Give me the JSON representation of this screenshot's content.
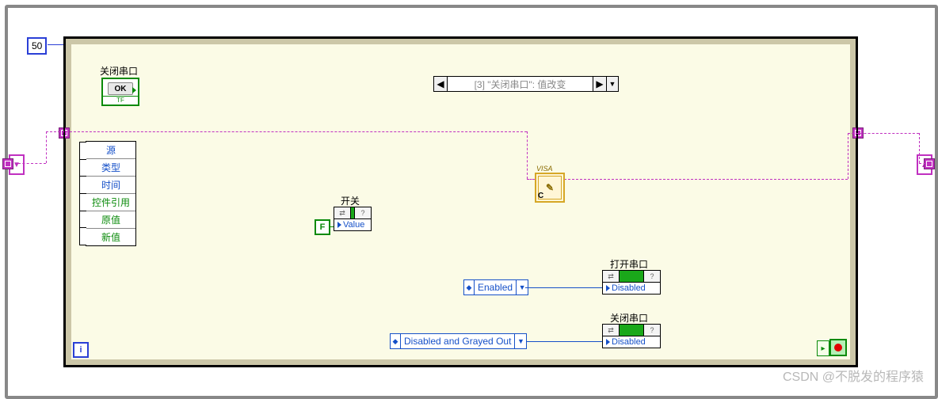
{
  "wait_ms": "50",
  "case_selector": "[3] \"关闭串口\": 值改变",
  "close_serial_label": "关闭串口",
  "ok_button_label": "OK",
  "tf_label": "TF",
  "unbundle_items": {
    "i0": "源",
    "i1": "类型",
    "i2": "时间",
    "i3": "控件引用",
    "i4": "原值",
    "i5": "新值"
  },
  "visa_tag": "VISA",
  "visa_c": "C",
  "switch_label": "开关",
  "switch_prop": "Value",
  "false_const": "F",
  "open_serial_label": "打开串口",
  "open_serial_prop": "Disabled",
  "close_serial2_label": "关闭串口",
  "close_serial2_prop": "Disabled",
  "ring_enabled": "Enabled",
  "ring_disabled_grayed": "Disabled and Grayed Out",
  "iteration_i": "i",
  "head_cell_l": "⇄",
  "head_cell_r": "?",
  "watermark": "CSDN @不脱发的程序猿"
}
